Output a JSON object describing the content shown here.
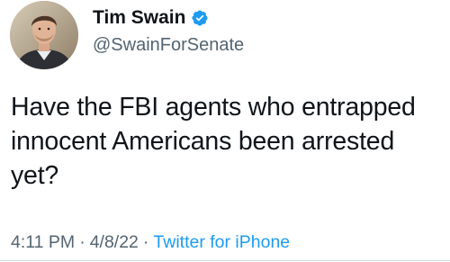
{
  "author": {
    "display_name": "Tim Swain",
    "handle": "@SwainForSenate",
    "verified": true,
    "avatar_icon": "profile-photo",
    "verified_icon": "verified-badge-icon"
  },
  "tweet": {
    "text": "Have the FBI agents who entrapped\ninnocent Americans been arrested\nyet?"
  },
  "meta": {
    "time": "4:11 PM",
    "separator": "·",
    "date": "4/8/22",
    "source": "Twitter for iPhone"
  },
  "colors": {
    "text": "#0f1419",
    "secondary": "#536471",
    "accent": "#1d9bf0"
  }
}
